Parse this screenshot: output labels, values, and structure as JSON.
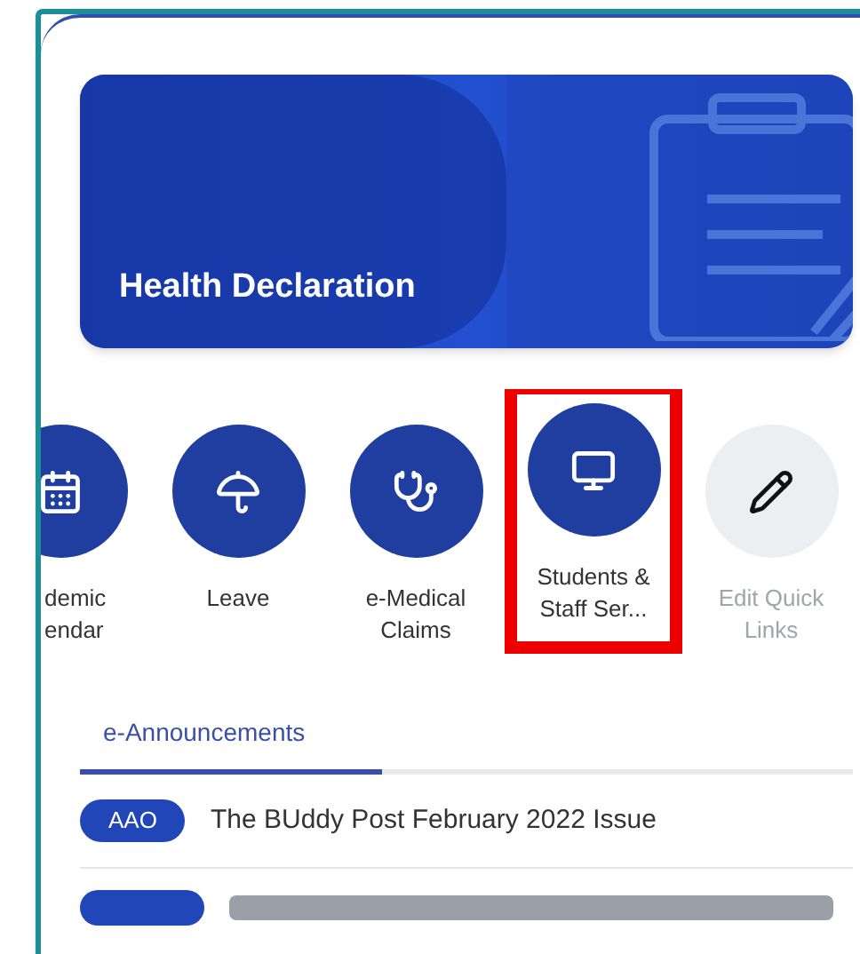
{
  "banner": {
    "title": "Health Declaration"
  },
  "quick_links": [
    {
      "kind": "link",
      "label": "demic\nendar",
      "highlighted": false
    },
    {
      "kind": "link",
      "label": "Leave",
      "highlighted": false
    },
    {
      "kind": "link",
      "label": "e-Medical\nClaims",
      "highlighted": false
    },
    {
      "kind": "link",
      "label": "Students &\nStaff Ser...",
      "highlighted": true
    },
    {
      "kind": "edit",
      "label": "Edit Quick\nLinks",
      "highlighted": false
    }
  ],
  "tabs": [
    {
      "label": "e-Announcements",
      "selected": true
    }
  ],
  "announcements": [
    {
      "badge": "AAO",
      "title": "The BUddy Post February 2022 Issue"
    }
  ]
}
